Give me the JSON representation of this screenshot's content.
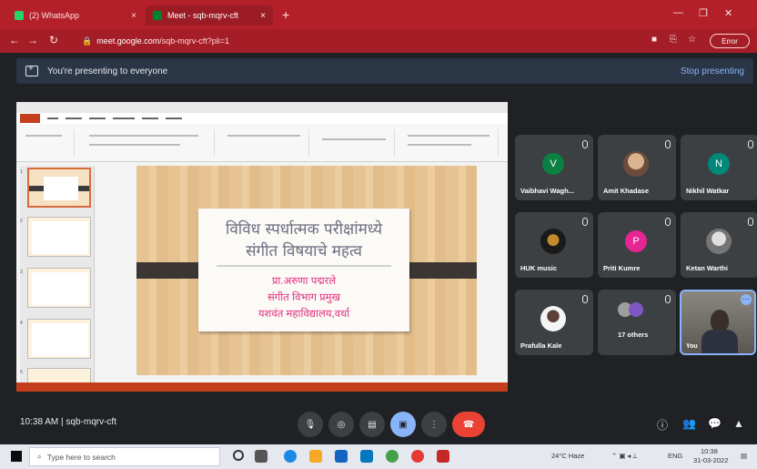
{
  "browser": {
    "tabs": [
      {
        "label": "(2) WhatsApp",
        "fav_color": "#25d366"
      },
      {
        "label": "Meet - sqb-mqrv-cft",
        "fav_color": "#00832d"
      }
    ],
    "new_tab": "+",
    "url_host": "meet.google.com",
    "url_path": "/sqb-mqrv-cft?pli=1",
    "profile_label": "Error"
  },
  "banner": {
    "text": "You're presenting to everyone",
    "stop": "Stop presenting"
  },
  "slide": {
    "title_line1": "विविध स्पर्धात्मक परीक्षांमध्ये",
    "title_line2": "संगीत विषयाचे महत्व",
    "presenter_line1": "प्रा.अरुणा पद्मरले",
    "presenter_line2": "संगीत विभाग प्रमुख",
    "presenter_line3": "यशवंत महाविद्यालय,वर्धा",
    "thumb_numbers": [
      "1",
      "2",
      "3",
      "4",
      "5"
    ]
  },
  "participants": [
    {
      "name": "Vaibhavi Wagh...",
      "initial": "V",
      "color": "#0b8043"
    },
    {
      "name": "Amit Khadase",
      "initial": "",
      "color": "#8d6e63"
    },
    {
      "name": "Nikhil Watkar",
      "initial": "N",
      "color": "#00897b"
    },
    {
      "name": "HUK music",
      "initial": "",
      "color": "#2b2b2b"
    },
    {
      "name": "Priti Kumre",
      "initial": "P",
      "color": "#e52592"
    },
    {
      "name": "Ketan Warthi",
      "initial": "",
      "color": "#9e9e9e"
    },
    {
      "name": "Prafulla Kale",
      "initial": "",
      "color": "#d7ccc8"
    },
    {
      "name": "17 others",
      "initial": "",
      "color": "#5f6368"
    }
  ],
  "self_tile": {
    "name": "You",
    "menu": "⋯"
  },
  "meet": {
    "time_code": "10:38 AM | sqb-mqrv-cft",
    "controls": [
      "mic-icon",
      "camera-icon",
      "captions-icon",
      "present-icon",
      "more-icon",
      "end-call-icon"
    ],
    "right_controls": [
      "info-icon",
      "people-icon",
      "chat-icon",
      "activities-icon"
    ]
  },
  "taskbar": {
    "search_placeholder": "Type here to search",
    "weather": "24°C Haze",
    "lang": "ENG",
    "time": "10:38",
    "date": "31-03-2022"
  }
}
